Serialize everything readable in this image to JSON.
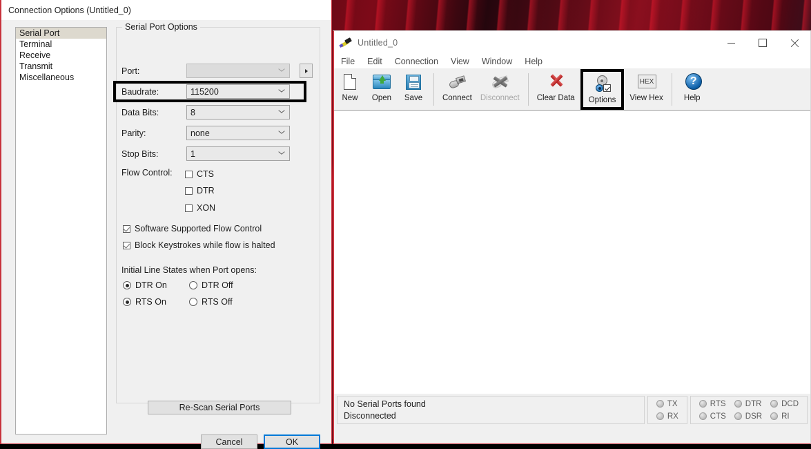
{
  "dialog": {
    "title": "Connection Options (Untitled_0)",
    "nav": {
      "items": [
        {
          "label": "Serial Port",
          "selected": true
        },
        {
          "label": "Terminal",
          "selected": false
        },
        {
          "label": "Receive",
          "selected": false
        },
        {
          "label": "Transmit",
          "selected": false
        },
        {
          "label": "Miscellaneous",
          "selected": false
        }
      ]
    },
    "group_legend": "Serial Port Options",
    "fields": [
      {
        "label": "Port:",
        "value": "",
        "disabled": true
      },
      {
        "label": "Baudrate:",
        "value": "115200",
        "disabled": false,
        "highlighted": true
      },
      {
        "label": "Data Bits:",
        "value": "8",
        "disabled": false
      },
      {
        "label": "Parity:",
        "value": "none",
        "disabled": false
      },
      {
        "label": "Stop Bits:",
        "value": "1",
        "disabled": false
      }
    ],
    "flow_control": {
      "label": "Flow Control:",
      "checkboxes": [
        {
          "label": "CTS",
          "checked": false
        },
        {
          "label": "DTR",
          "checked": false
        },
        {
          "label": "XON",
          "checked": false
        }
      ]
    },
    "extra_checkboxes": [
      {
        "label": "Software Supported Flow Control",
        "checked": true
      },
      {
        "label": "Block Keystrokes while flow is halted",
        "checked": true
      }
    ],
    "initial_line_states": {
      "label": "Initial Line States when Port opens:",
      "radios": [
        {
          "label": "DTR On",
          "checked": true
        },
        {
          "label": "DTR Off",
          "checked": false
        },
        {
          "label": "RTS On",
          "checked": true
        },
        {
          "label": "RTS Off",
          "checked": false
        }
      ]
    },
    "rescan_label": "Re-Scan Serial Ports",
    "cancel_label": "Cancel",
    "ok_label": "OK",
    "port_more_label": "▸",
    "highlight_color": "#000000",
    "ok_focus_color": "#0078d7"
  },
  "terminal_window": {
    "title": "Untitled_0",
    "icon": "terminal-app-icon",
    "window_buttons": [
      {
        "name": "minimize",
        "glyph": "—"
      },
      {
        "name": "maximize",
        "glyph": "□"
      },
      {
        "name": "close",
        "glyph": "✕"
      }
    ],
    "menu": [
      "File",
      "Edit",
      "Connection",
      "View",
      "Window",
      "Help"
    ],
    "toolbar": [
      {
        "label": "New",
        "icon": "new-document-icon",
        "enabled": true,
        "highlighted": false
      },
      {
        "label": "Open",
        "icon": "open-folder-icon",
        "enabled": true,
        "highlighted": false
      },
      {
        "label": "Save",
        "icon": "floppy-disk-icon",
        "enabled": true,
        "highlighted": false
      },
      {
        "label": "Connect",
        "icon": "usb-connect-icon",
        "enabled": true,
        "highlighted": false
      },
      {
        "label": "Disconnect",
        "icon": "usb-disconnect-icon",
        "enabled": false,
        "highlighted": false
      },
      {
        "label": "Clear Data",
        "icon": "red-x-icon",
        "enabled": true,
        "highlighted": false
      },
      {
        "label": "Options",
        "icon": "gear-options-icon",
        "enabled": true,
        "highlighted": true
      },
      {
        "label": "View Hex",
        "icon": "hex-icon",
        "enabled": true,
        "highlighted": false
      },
      {
        "label": "Help",
        "icon": "blue-question-help-icon",
        "enabled": true,
        "highlighted": false
      }
    ],
    "terminal_content": "",
    "status": {
      "line1": "No Serial Ports found",
      "line2": "Disconnected",
      "leds_group1": [
        {
          "label": "TX",
          "on": false
        },
        {
          "label": "RX",
          "on": false
        }
      ],
      "leds_group2": [
        {
          "label": "RTS",
          "on": false
        },
        {
          "label": "CTS",
          "on": false
        },
        {
          "label": "DTR",
          "on": false
        },
        {
          "label": "DSR",
          "on": false
        },
        {
          "label": "DCD",
          "on": false
        },
        {
          "label": "RI",
          "on": false
        }
      ]
    }
  }
}
